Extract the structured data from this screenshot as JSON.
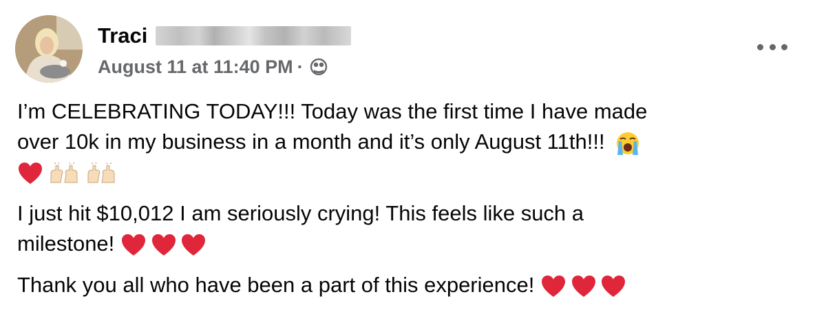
{
  "post": {
    "author_first_name": "Traci",
    "timestamp": "August 11 at 11:40 PM",
    "separator": "·",
    "audience_icon": "globe-icon",
    "more_icon": "more-options-icon",
    "paragraphs": {
      "p1_line1": "I’m CELEBRATING TODAY!!! Today was the first time I have made",
      "p1_line2": "over 10k in my business in a month and it’s only August 11th!!!",
      "p2_line1": "I just hit $10,012 I am seriously crying! This feels like such a",
      "p2_line2": "milestone!",
      "p3_line1": "Thank you all who have been a part of this experience!"
    },
    "emojis": {
      "cry": "loudly-crying-face-icon",
      "heart": "red-heart-icon",
      "raised_hands": "raised-hands-icon"
    },
    "colors": {
      "text": "#050505",
      "secondary": "#65676b",
      "heart": "#e0263a"
    }
  }
}
